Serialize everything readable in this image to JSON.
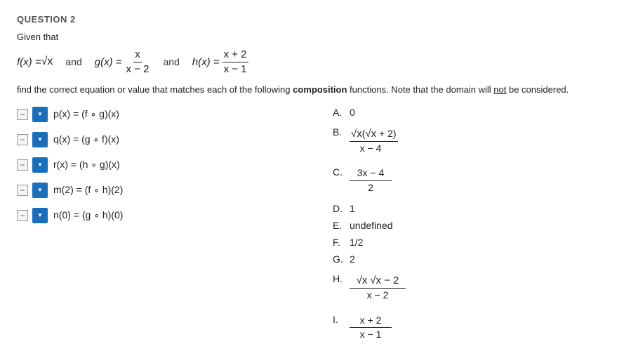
{
  "page": {
    "question_header": "QUESTION 2",
    "given_that": "Given that",
    "functions": {
      "f": "f(x) = √x",
      "connector1": "and",
      "g_label": "g(x) =",
      "g_num": "x",
      "g_den": "x − 2",
      "connector2": "and",
      "h_label": "h(x) =",
      "h_num": "x + 2",
      "h_den": "x − 1"
    },
    "instruction": "find the correct equation or value that matches each of the following",
    "bold_word": "composition",
    "instruction2": "functions.  Note that the domain will",
    "underline_word": "not",
    "instruction3": "be considered.",
    "questions": [
      {
        "id": "p",
        "label": "p(x) = (f ∘ g)(x)"
      },
      {
        "id": "q",
        "label": "q(x) = (g ∘ f)(x)"
      },
      {
        "id": "r",
        "label": "r(x) = (h ∘ g)(x)"
      },
      {
        "id": "m",
        "label": "m(2) = (f ∘ h)(2)"
      },
      {
        "id": "n",
        "label": "n(0) = (g ∘ h)(0)"
      }
    ],
    "answers": [
      {
        "letter": "A.",
        "type": "text",
        "value": "0"
      },
      {
        "letter": "B.",
        "type": "fraction-sqrt",
        "num": "√x(√x + 2)",
        "den": "x − 4"
      },
      {
        "letter": "C.",
        "type": "fraction",
        "num": "3x − 4",
        "den": "2"
      },
      {
        "letter": "D.",
        "type": "text",
        "value": "1"
      },
      {
        "letter": "E.",
        "type": "text",
        "value": "undefined"
      },
      {
        "letter": "F.",
        "type": "text",
        "value": "1/2"
      },
      {
        "letter": "G.",
        "type": "text",
        "value": "2"
      },
      {
        "letter": "H.",
        "type": "fraction-sqrt2",
        "num": "√x √x − 2",
        "den": "x − 2"
      },
      {
        "letter": "I.",
        "type": "fraction",
        "num": "x + 2",
        "den": "x − 1"
      }
    ]
  }
}
